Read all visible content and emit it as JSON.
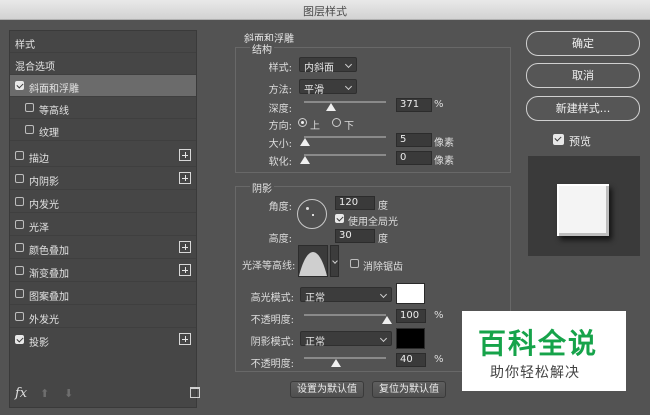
{
  "window": {
    "title": "图层样式"
  },
  "sidebar": {
    "header": "样式",
    "blend_options": "混合选项",
    "items": [
      {
        "label": "斜面和浮雕",
        "checked": true,
        "selected": true
      },
      {
        "label": "等高线",
        "checked": false
      },
      {
        "label": "纹理",
        "checked": false
      },
      {
        "label": "描边",
        "checked": false
      },
      {
        "label": "内阴影",
        "checked": false
      },
      {
        "label": "内发光",
        "checked": false
      },
      {
        "label": "光泽",
        "checked": false
      },
      {
        "label": "颜色叠加",
        "checked": false
      },
      {
        "label": "渐变叠加",
        "checked": false
      },
      {
        "label": "图案叠加",
        "checked": false
      },
      {
        "label": "外发光",
        "checked": false
      },
      {
        "label": "投影",
        "checked": true
      }
    ],
    "footer": {
      "fx": "fx",
      "up": "⬆",
      "down": "⬇"
    }
  },
  "bevel": {
    "section_title": "斜面和浮雕",
    "structure": {
      "title": "结构",
      "style_label": "样式:",
      "style_value": "内斜面",
      "technique_label": "方法:",
      "technique_value": "平滑",
      "depth_label": "深度:",
      "depth_value": "371",
      "depth_unit": "%",
      "depth_level": 0.33,
      "direction_label": "方向:",
      "direction_up": "上",
      "direction_down": "下",
      "size_label": "大小:",
      "size_value": "5",
      "size_unit": "像素",
      "soften_label": "软化:",
      "soften_value": "0",
      "soften_unit": "像素"
    },
    "shading": {
      "title": "阴影",
      "angle_label": "角度:",
      "angle_value": "120",
      "angle_unit": "度",
      "global_light_label": "使用全局光",
      "global_light_checked": true,
      "altitude_label": "高度:",
      "altitude_value": "30",
      "altitude_unit": "度",
      "gloss_contour_label": "光泽等高线:",
      "antialias_label": "消除锯齿",
      "antialias_checked": false,
      "highlight_mode_label": "高光模式:",
      "highlight_mode_value": "正常",
      "highlight_color": "#ffffff",
      "highlight_opacity_label": "不透明度:",
      "highlight_opacity_value": "100",
      "opacity_unit": "%",
      "shadow_mode_label": "阴影模式:",
      "shadow_mode_value": "正常",
      "shadow_color": "#000000",
      "shadow_opacity_label": "不透明度:",
      "shadow_opacity_value": "40"
    },
    "set_default": "设置为默认值",
    "reset_default": "复位为默认值"
  },
  "actions": {
    "ok": "确定",
    "cancel": "取消",
    "new_style": "新建样式...",
    "preview_label": "预览",
    "preview_checked": true
  },
  "watermark": {
    "title": "百科全说",
    "subtitle": "助你轻松解决"
  }
}
